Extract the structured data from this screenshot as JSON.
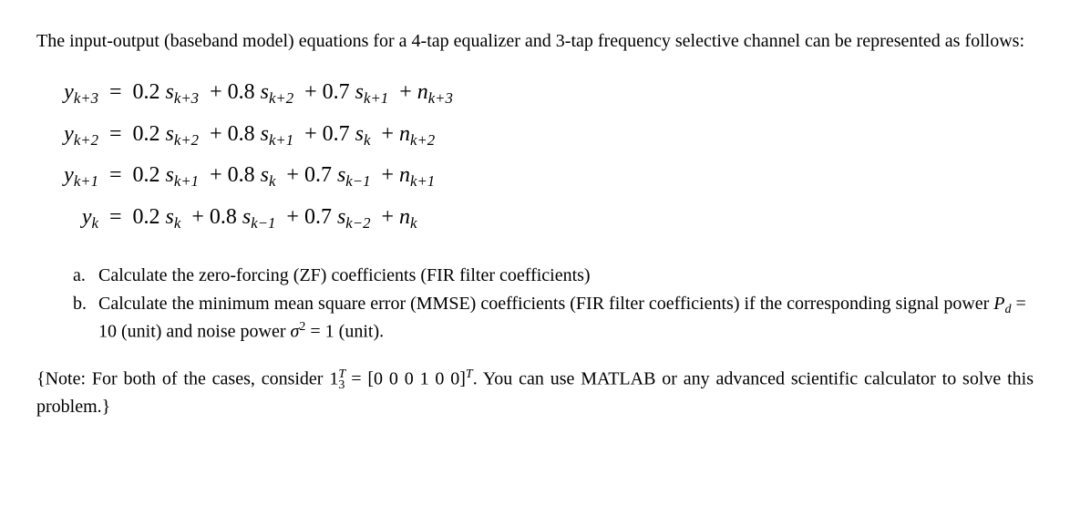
{
  "intro": "The input-output (baseband model) equations for a 4-tap equalizer and 3-tap frequency selective channel can be represented as follows:",
  "eq": {
    "c1": "0.2",
    "c2": "0.8",
    "c3": "0.7",
    "rows": [
      {
        "y_sub": "k+3",
        "s1_sub": "k+3",
        "s2_sub": "k+2",
        "s3_sub": "k+1",
        "n_sub": "k+3"
      },
      {
        "y_sub": "k+2",
        "s1_sub": "k+2",
        "s2_sub": "k+1",
        "s3_sub": "k",
        "n_sub": "k+2"
      },
      {
        "y_sub": "k+1",
        "s1_sub": "k+1",
        "s2_sub": "k",
        "s3_sub": "k−1",
        "n_sub": "k+1"
      },
      {
        "y_sub": "k",
        "s1_sub": "k",
        "s2_sub": "k−1",
        "s3_sub": "k−2",
        "n_sub": "k"
      }
    ]
  },
  "parts": {
    "a_marker": "a.",
    "a_text": "Calculate the zero-forcing (ZF) coefficients (FIR filter coefficients)",
    "b_marker": "b.",
    "b_text_pre": "Calculate the minimum mean square error (MMSE) coefficients (FIR filter coefficients) if the corresponding signal power ",
    "b_pd": "P",
    "b_pd_sub": "d",
    "b_pd_eq": " = 10 (unit) and noise power ",
    "b_sigma": "σ",
    "b_sigma_sup": "2",
    "b_sigma_eq": " = 1 (unit)."
  },
  "note": {
    "pre": "{Note: For both of the cases, consider ",
    "one": "1",
    "one_sub": "3",
    "one_sup": "T",
    "mid": " = [0 0 0 1 0 0]",
    "vec_sup": "T",
    "post": ". You can use MATLAB or any advanced scientific calculator to solve this problem.}"
  }
}
